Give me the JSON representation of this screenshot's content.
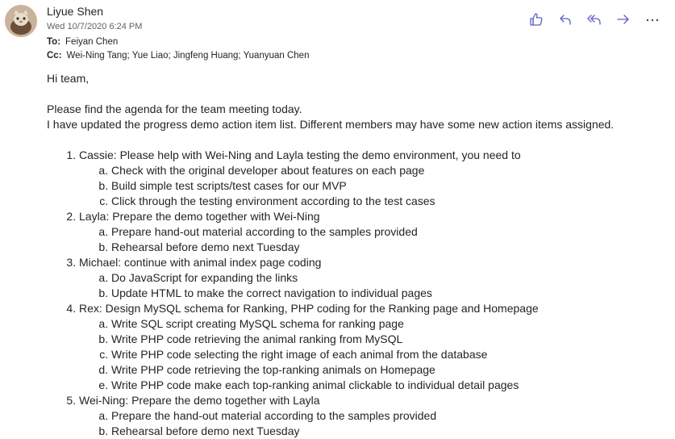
{
  "sender": {
    "name": "Liyue Shen",
    "date": "Wed 10/7/2020 6:24 PM"
  },
  "to": {
    "label": "To:",
    "value": "Feiyan Chen"
  },
  "cc": {
    "label": "Cc:",
    "value": "Wei-Ning Tang; Yue Liao; Jingfeng Huang; Yuanyuan Chen"
  },
  "actions": [
    {
      "name": "like-icon"
    },
    {
      "name": "reply-icon"
    },
    {
      "name": "reply-all-icon"
    },
    {
      "name": "forward-icon"
    },
    {
      "name": "more-icon"
    }
  ],
  "body": {
    "greeting": "Hi team,",
    "para1": "Please find the agenda for the team meeting today.",
    "para2": "I have updated the progress demo action item list. Different members may have some new action items assigned.",
    "items": [
      {
        "text": "Cassie: Please help with Wei-Ning and Layla testing the demo environment, you need to",
        "sub": [
          "Check with the original developer about features on each page",
          "Build simple test scripts/test cases for our MVP",
          "Click through the testing environment according to the test cases"
        ]
      },
      {
        "text": "Layla: Prepare the demo together with Wei-Ning",
        "sub": [
          "Prepare hand-out material according to the samples provided",
          "Rehearsal before demo next Tuesday"
        ]
      },
      {
        "text": "Michael: continue with animal index page coding",
        "sub": [
          "Do JavaScript for expanding the links",
          "Update HTML to make the correct navigation to individual pages"
        ]
      },
      {
        "text": "Rex: Design MySQL schema for Ranking, PHP coding for the Ranking page and Homepage",
        "sub": [
          "Write SQL script creating MySQL schema for ranking page",
          "Write PHP code retrieving the animal ranking from MySQL",
          "Write PHP code selecting the right image of each animal from the database",
          "Write PHP code retrieving the top-ranking animals on Homepage",
          "Write PHP code make each top-ranking animal clickable to individual detail pages"
        ]
      },
      {
        "text": "Wei-Ning: Prepare the demo together with Layla",
        "sub": [
          "Prepare the hand-out material according to the samples provided",
          "Rehearsal before demo next Tuesday"
        ]
      }
    ]
  }
}
